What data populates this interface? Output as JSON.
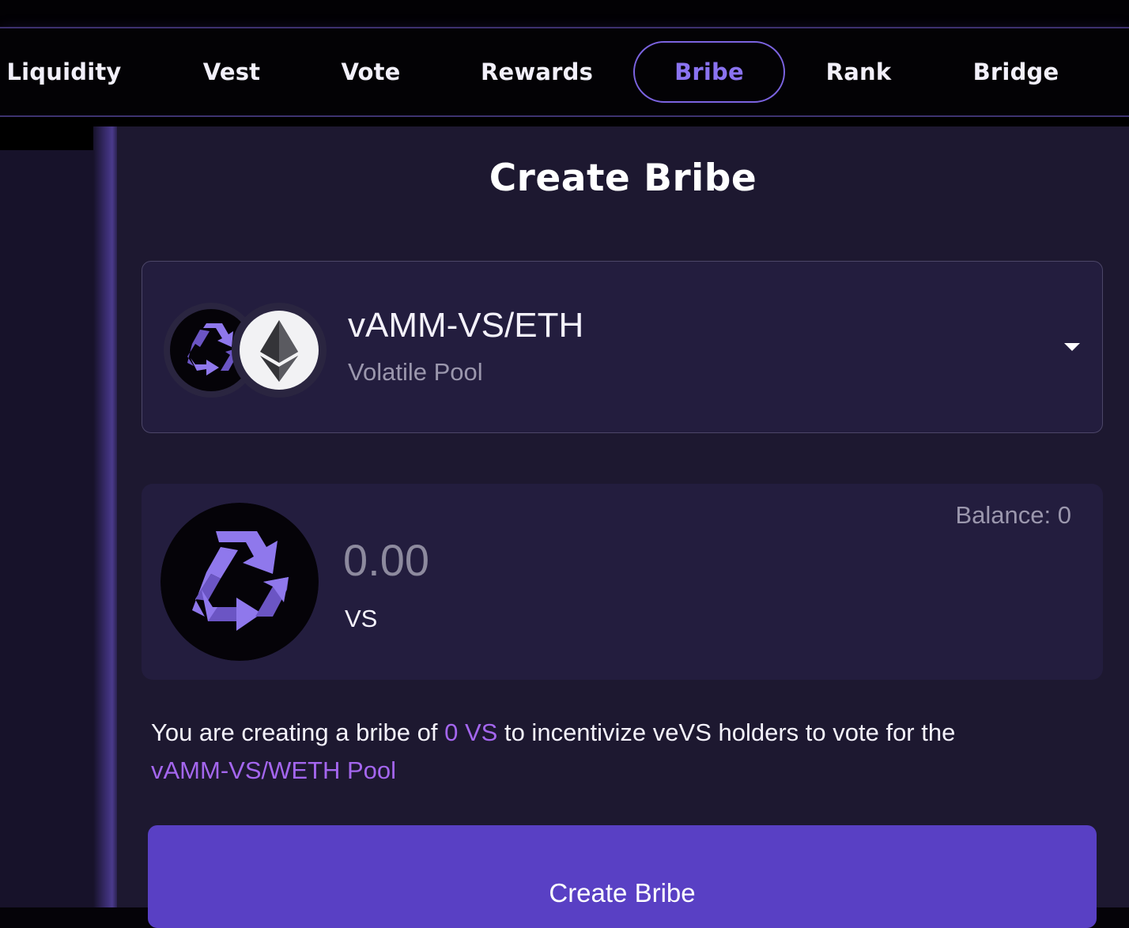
{
  "nav": {
    "items": [
      {
        "label": "Liquidity"
      },
      {
        "label": "Vest"
      },
      {
        "label": "Vote"
      },
      {
        "label": "Rewards"
      },
      {
        "label": "Bribe",
        "active": true
      },
      {
        "label": "Rank"
      },
      {
        "label": "Bridge"
      }
    ]
  },
  "page": {
    "title": "Create Bribe"
  },
  "pool_select": {
    "name": "vAMM-VS/ETH",
    "type": "Volatile Pool",
    "token_icons": [
      "vs-recycle-icon",
      "eth-icon"
    ]
  },
  "amount": {
    "balance": "Balance: 0",
    "placeholder": "0.00",
    "symbol": "VS",
    "token_icon": "vs-recycle-icon"
  },
  "info": {
    "prefix": "You are creating a bribe of",
    "amount": "0 VS",
    "middle": "to incentivize veVS holders to vote for the",
    "pool": "vAMM-VS/WETH Pool"
  },
  "actions": {
    "create_label": "Create Bribe"
  },
  "colors": {
    "accent": "#5940c4",
    "highlight": "#a466ee",
    "active_nav": "#8a73f0",
    "card_bg": "#231d3e",
    "page_bg": "#1d1830"
  }
}
